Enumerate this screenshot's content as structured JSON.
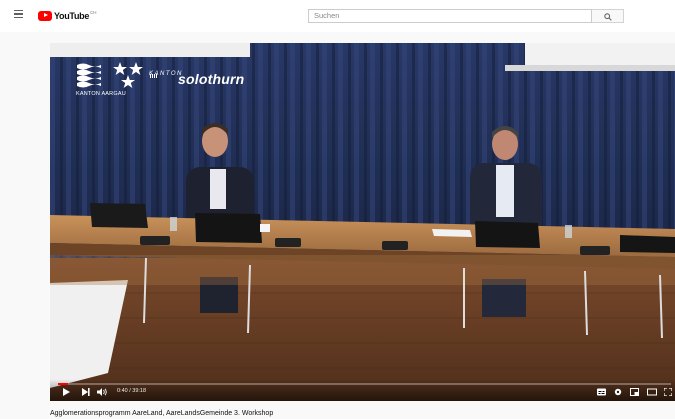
{
  "header": {
    "menu_icon": "hamburger-menu-icon",
    "logo_text": "YouTube",
    "logo_suffix": "CH",
    "search_placeholder": "Suchen",
    "search_icon": "search-icon"
  },
  "video": {
    "overlay": {
      "kanton_label": "KANTON",
      "kanton_name": "solothurn",
      "aargau_label": "KANTON AARGAU"
    },
    "controls": {
      "time": "0:40 / 39:18",
      "progress": 0.017,
      "icons": [
        "play-icon",
        "next-icon",
        "volume-icon",
        "subtitles-icon",
        "settings-icon",
        "miniplayer-icon",
        "theater-icon",
        "fullscreen-icon"
      ]
    }
  },
  "video_title": "Agglomerationsprogramm AareLand, AareLandsGemeinde 3. Workshop",
  "colors": {
    "brand": "#ff0000",
    "progress": "#ff0000",
    "curtain": "#22315a"
  }
}
